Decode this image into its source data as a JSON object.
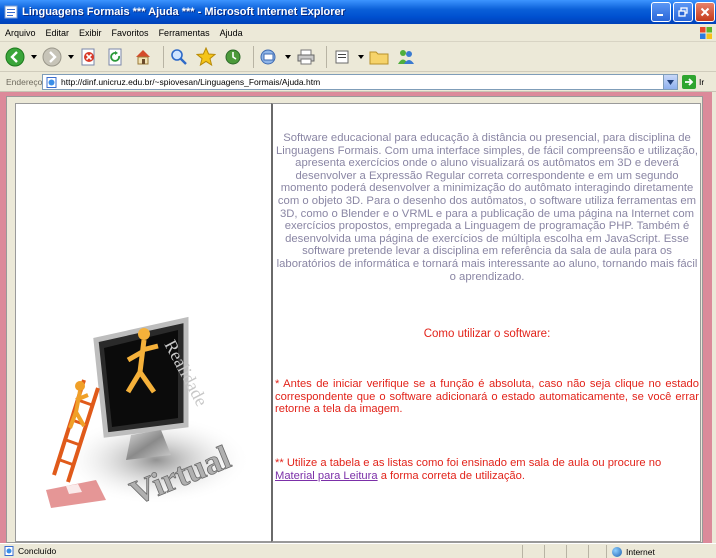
{
  "window": {
    "title": "Linguagens Formais *** Ajuda *** - Microsoft Internet Explorer"
  },
  "menu": [
    "Arquivo",
    "Editar",
    "Exibir",
    "Favoritos",
    "Ferramentas",
    "Ajuda"
  ],
  "address": {
    "label": "Endereço",
    "url": "http://dinf.unicruz.edu.br/~spiovesan/Linguagens_Formais/Ajuda.htm",
    "go_label": "Ir"
  },
  "page": {
    "intro": "Software educacional para educação à distância ou presencial, para disciplina de Linguagens Formais. Com uma interface simples, de fácil compreensão e utilização, apresenta exercícios onde o aluno visualizará os autômatos em 3D e deverá desenvolver a Expressão Regular correta correspondente e em um segundo momento poderá desenvolver a minimização do autômato interagindo diretamente com o objeto 3D. Para o desenho dos autômatos, o software utiliza ferramentas em 3D, como o Blender e o VRML e para a publicação de uma página na Internet com exercícios propostos, empregada a Linguagem de programação PHP. Também é desenvolvida uma página de exercícios de múltipla escolha em JavaScript. Esse software pretende levar a disciplina em referência da sala de aula para os laboratórios de informática e tornará mais interessante ao aluno, tornando mais fácil o aprendizado.",
    "howto_title": "Como utilizar o software:",
    "note1": "* Antes de iniciar verifique se a função é absoluta, caso não seja clique no estado correspondente que o software adicionará o estado automaticamente, se você errar retorne a tela da imagem.",
    "note2_before": "** Utilize a tabela e as listas como foi ensinado em sala de aula ou procure no ",
    "note2_link": "Material para Leitura",
    "note2_after": " a forma correta de utilização.",
    "illustration_words": [
      "Realidade",
      "Virtual"
    ]
  },
  "status": {
    "text": "Concluído",
    "zone": "Internet"
  },
  "colors": {
    "intro_text": "#8a86a4",
    "red_text": "#e2231a",
    "link": "#7b2fa8",
    "page_background": "#dc8a9a"
  },
  "icons": [
    "back-icon",
    "forward-icon",
    "stop-icon",
    "refresh-icon",
    "home-icon",
    "search-icon",
    "favorites-icon",
    "history-icon",
    "mail-icon",
    "print-icon",
    "edit-icon",
    "folder-icon",
    "messenger-icon"
  ]
}
